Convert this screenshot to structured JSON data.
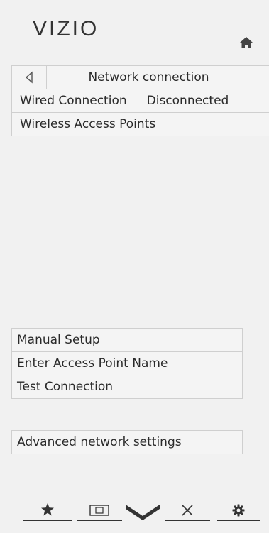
{
  "header": {
    "logo": "VIZIO",
    "home_icon": "home-icon"
  },
  "network": {
    "back_icon": "back-arrow-icon",
    "title": "Network connection",
    "rows": [
      {
        "label": "Wired Connection",
        "status": "Disconnected"
      },
      {
        "label": "Wireless Access Points",
        "status": ""
      }
    ]
  },
  "setup_menu": [
    {
      "label": "Manual Setup"
    },
    {
      "label": "Enter Access Point Name"
    },
    {
      "label": "Test Connection"
    }
  ],
  "advanced": {
    "label": "Advanced network settings"
  },
  "bottom_nav": [
    {
      "icon": "star-icon"
    },
    {
      "icon": "input-icon"
    },
    {
      "icon": "vizio-v-icon"
    },
    {
      "icon": "close-icon"
    },
    {
      "icon": "gear-icon"
    }
  ]
}
